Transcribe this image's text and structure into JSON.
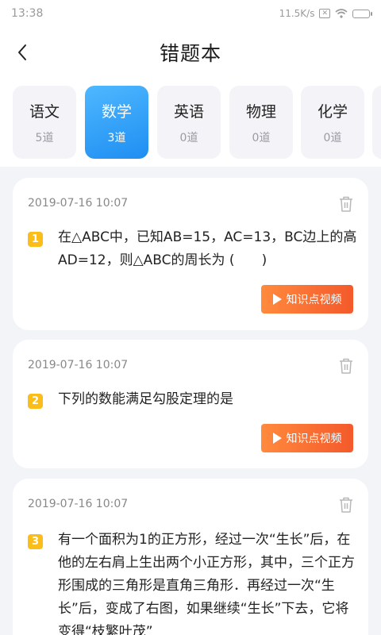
{
  "status_bar": {
    "time": "13:38",
    "speed": "11.5K/s",
    "icons": [
      "no-sim-icon",
      "wifi-icon",
      "battery-icon"
    ]
  },
  "header": {
    "title": "错题本",
    "back_icon": "chevron-left-icon"
  },
  "tabs": [
    {
      "name": "语文",
      "count": "5道",
      "active": false
    },
    {
      "name": "数学",
      "count": "3道",
      "active": true
    },
    {
      "name": "英语",
      "count": "0道",
      "active": false
    },
    {
      "name": "物理",
      "count": "0道",
      "active": false
    },
    {
      "name": "化学",
      "count": "0道",
      "active": false
    }
  ],
  "questions": [
    {
      "date": "2019-07-16 10:07",
      "number": "1",
      "text": "在△ABC中，已知AB=15，AC=13，BC边上的高AD=12，则△ABC的周长为 (　　)",
      "button": "知识点视频"
    },
    {
      "date": "2019-07-16 10:07",
      "number": "2",
      "text": "下列的数能满足勾股定理的是",
      "button": "知识点视频"
    },
    {
      "date": "2019-07-16 10:07",
      "number": "3",
      "text": "有一个面积为1的正方形，经过一次“生长”后，在他的左右肩上生出两个小正方形，其中，三个正方形围成的三角形是直角三角形．再经过一次“生长”后，变成了右图，如果继续“生长”下去，它将变得“枝繁叶茂”",
      "button": ""
    }
  ],
  "colors": {
    "accent_blue": "#1e8ef2",
    "badge_yellow": "#fbbd1a",
    "video_orange": "#f4592b"
  }
}
